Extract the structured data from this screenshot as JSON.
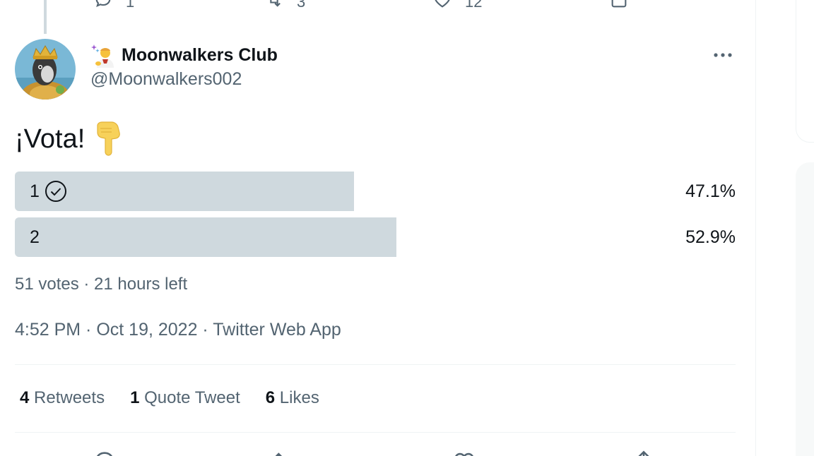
{
  "previous_tweet": {
    "reply_count": "1",
    "retweet_count": "3",
    "like_count": "12"
  },
  "tweet": {
    "display_name": "Moonwalkers Club",
    "handle": "@Moonwalkers002",
    "text": "¡Vota!",
    "emoji_name": "person-gesturing-emoji",
    "text_emoji_name": "backhand-index-pointing-down-emoji"
  },
  "poll": {
    "options": [
      {
        "label": "1",
        "percent_text": "47.1%",
        "fraction": 0.471,
        "selected": true
      },
      {
        "label": "2",
        "percent_text": "52.9%",
        "fraction": 0.529,
        "selected": false
      }
    ],
    "meta": "51 votes · 21 hours left",
    "bar_color": "#cfd9de"
  },
  "timestamp": {
    "time": "4:52 PM",
    "date": "Oct 19, 2022",
    "source": "Twitter Web App",
    "separator": " · "
  },
  "stats": {
    "retweets_count": "4",
    "retweets_label": "Retweets",
    "quotes_count": "1",
    "quotes_label": "Quote Tweet",
    "likes_count": "6",
    "likes_label": "Likes"
  },
  "colors": {
    "text_primary": "#0f1419",
    "text_secondary": "#536471",
    "divider": "#eff3f4"
  }
}
